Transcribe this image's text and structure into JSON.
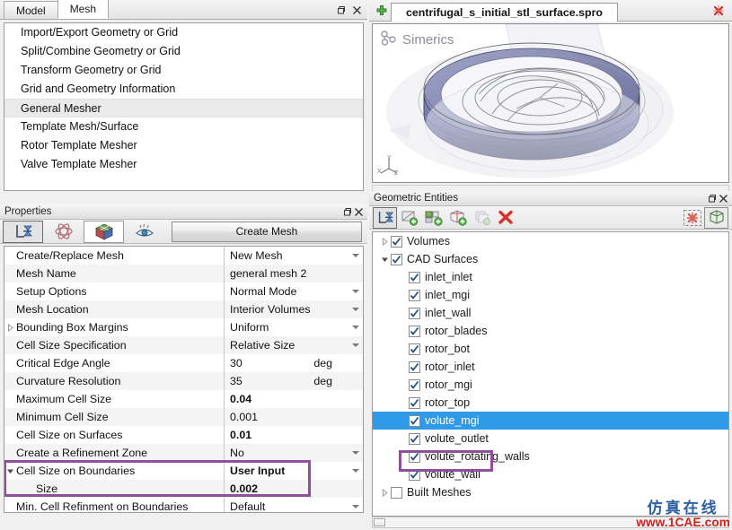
{
  "left_top_panel": {
    "tabs": [
      {
        "label": "Model",
        "active": false
      },
      {
        "label": "Mesh",
        "active": true
      }
    ],
    "window_buttons": {
      "restore": "restore-icon",
      "close": "close-icon"
    },
    "menu_items": [
      {
        "label": "Import/Export Geometry or Grid",
        "selected": false
      },
      {
        "label": "Split/Combine Geometry or Grid",
        "selected": false
      },
      {
        "label": "Transform Geometry or Grid",
        "selected": false
      },
      {
        "label": "Grid and Geometry Information",
        "selected": false
      },
      {
        "label": "General Mesher",
        "selected": true
      },
      {
        "label": "Template Mesh/Surface",
        "selected": false
      },
      {
        "label": "Rotor Template Mesher",
        "selected": false
      },
      {
        "label": "Valve Template Mesher",
        "selected": false
      }
    ]
  },
  "properties_panel": {
    "title": "Properties",
    "icon_tabs": [
      {
        "name": "list-layout-icon",
        "state": "pressed"
      },
      {
        "name": "atom-physics-icon",
        "state": "normal"
      },
      {
        "name": "mesh-cube-icon",
        "state": "selected"
      },
      {
        "name": "eye-visibility-icon",
        "state": "normal"
      }
    ],
    "create_button": "Create Mesh",
    "rows": [
      {
        "name": "Create/Replace Mesh",
        "value": "New Mesh",
        "unit": "",
        "caret": true,
        "bold": false,
        "twisty": "",
        "indent": false
      },
      {
        "name": "Mesh Name",
        "value": "general mesh 2",
        "unit": "",
        "caret": false,
        "bold": false,
        "twisty": "",
        "indent": false
      },
      {
        "name": "Setup Options",
        "value": "Normal Mode",
        "unit": "",
        "caret": true,
        "bold": false,
        "twisty": "",
        "indent": false
      },
      {
        "name": "Mesh Location",
        "value": "Interior Volumes",
        "unit": "",
        "caret": true,
        "bold": false,
        "twisty": "",
        "indent": false
      },
      {
        "name": "Bounding Box Margins",
        "value": "Uniform",
        "unit": "",
        "caret": true,
        "bold": false,
        "twisty": "collapsed",
        "indent": false
      },
      {
        "name": "Cell Size Specification",
        "value": "Relative Size",
        "unit": "",
        "caret": true,
        "bold": false,
        "twisty": "",
        "indent": false
      },
      {
        "name": "Critical Edge Angle",
        "value": "30",
        "unit": "deg",
        "caret": false,
        "bold": false,
        "twisty": "",
        "indent": false
      },
      {
        "name": "Curvature Resolution",
        "value": "35",
        "unit": "deg",
        "caret": false,
        "bold": false,
        "twisty": "",
        "indent": false
      },
      {
        "name": "Maximum Cell Size",
        "value": "0.04",
        "unit": "",
        "caret": false,
        "bold": true,
        "twisty": "",
        "indent": false
      },
      {
        "name": "Minimum Cell Size",
        "value": "0.001",
        "unit": "",
        "caret": false,
        "bold": false,
        "twisty": "",
        "indent": false
      },
      {
        "name": "Cell Size on Surfaces",
        "value": "0.01",
        "unit": "",
        "caret": false,
        "bold": true,
        "twisty": "",
        "indent": false
      },
      {
        "name": "Create a Refinement Zone",
        "value": "No",
        "unit": "",
        "caret": true,
        "bold": false,
        "twisty": "",
        "indent": false
      },
      {
        "name": "Cell Size on Boundaries",
        "value": "User Input",
        "unit": "",
        "caret": true,
        "bold": true,
        "twisty": "expanded",
        "indent": false
      },
      {
        "name": "Size",
        "value": "0.002",
        "unit": "",
        "caret": false,
        "bold": true,
        "twisty": "",
        "indent": true
      },
      {
        "name": "Min. Cell Refinment on Boundaries",
        "value": "Default",
        "unit": "",
        "caret": true,
        "bold": false,
        "twisty": "",
        "indent": false
      }
    ],
    "highlight_color": "#8e4f9e"
  },
  "project_tabs": {
    "add_icon": "add-plus-icon",
    "tab_label": "centrifugal_s_initial_stl_surface.spro",
    "close_icon": "close-project-icon"
  },
  "viewport": {
    "brand": "Simerics",
    "brand_icon": "simerics-logo-icon",
    "axis_icon": "axis-triad-icon",
    "model_color": "#5b5f8f"
  },
  "geometric_entities": {
    "title": "Geometric Entities",
    "toolbar": [
      {
        "name": "list-layout-icon",
        "state": "pressed"
      },
      {
        "name": "add-surface-icon",
        "state": "normal"
      },
      {
        "name": "add-group-icon",
        "state": "normal"
      },
      {
        "name": "add-volume-icon",
        "state": "normal"
      },
      {
        "name": "copy-entity-icon",
        "state": "disabled"
      },
      {
        "name": "delete-x-icon",
        "state": "normal"
      }
    ],
    "toolbar_right": [
      {
        "name": "clear-selection-icon",
        "state": "normal"
      },
      {
        "name": "show-box-icon",
        "state": "on"
      }
    ],
    "tree": [
      {
        "label": "Volumes",
        "checked": true,
        "level": 0,
        "twisty": "collapsed",
        "selected": false
      },
      {
        "label": "CAD Surfaces",
        "checked": true,
        "level": 0,
        "twisty": "expanded",
        "selected": false
      },
      {
        "label": "inlet_inlet",
        "checked": true,
        "level": 1,
        "twisty": "",
        "selected": false
      },
      {
        "label": "inlet_mgi",
        "checked": true,
        "level": 1,
        "twisty": "",
        "selected": false
      },
      {
        "label": "inlet_wall",
        "checked": true,
        "level": 1,
        "twisty": "",
        "selected": false
      },
      {
        "label": "rotor_blades",
        "checked": true,
        "level": 1,
        "twisty": "",
        "selected": false
      },
      {
        "label": "rotor_bot",
        "checked": true,
        "level": 1,
        "twisty": "",
        "selected": false
      },
      {
        "label": "rotor_inlet",
        "checked": true,
        "level": 1,
        "twisty": "",
        "selected": false
      },
      {
        "label": "rotor_mgi",
        "checked": true,
        "level": 1,
        "twisty": "",
        "selected": false
      },
      {
        "label": "rotor_top",
        "checked": true,
        "level": 1,
        "twisty": "",
        "selected": false
      },
      {
        "label": "volute_mgi",
        "checked": true,
        "level": 1,
        "twisty": "",
        "selected": true
      },
      {
        "label": "volute_outlet",
        "checked": true,
        "level": 1,
        "twisty": "",
        "selected": false
      },
      {
        "label": "volute_rotating_walls",
        "checked": true,
        "level": 1,
        "twisty": "",
        "selected": false
      },
      {
        "label": "volute_wall",
        "checked": true,
        "level": 1,
        "twisty": "",
        "selected": false
      },
      {
        "label": "Built Meshes",
        "checked": false,
        "level": 0,
        "twisty": "collapsed",
        "selected": false
      }
    ],
    "highlight_color": "#8e4f9e",
    "selection_color": "#2f9ae8"
  },
  "watermark": {
    "cn": "仿真在线",
    "url": "www.1CAE.com",
    "ghost": "1CAE"
  }
}
